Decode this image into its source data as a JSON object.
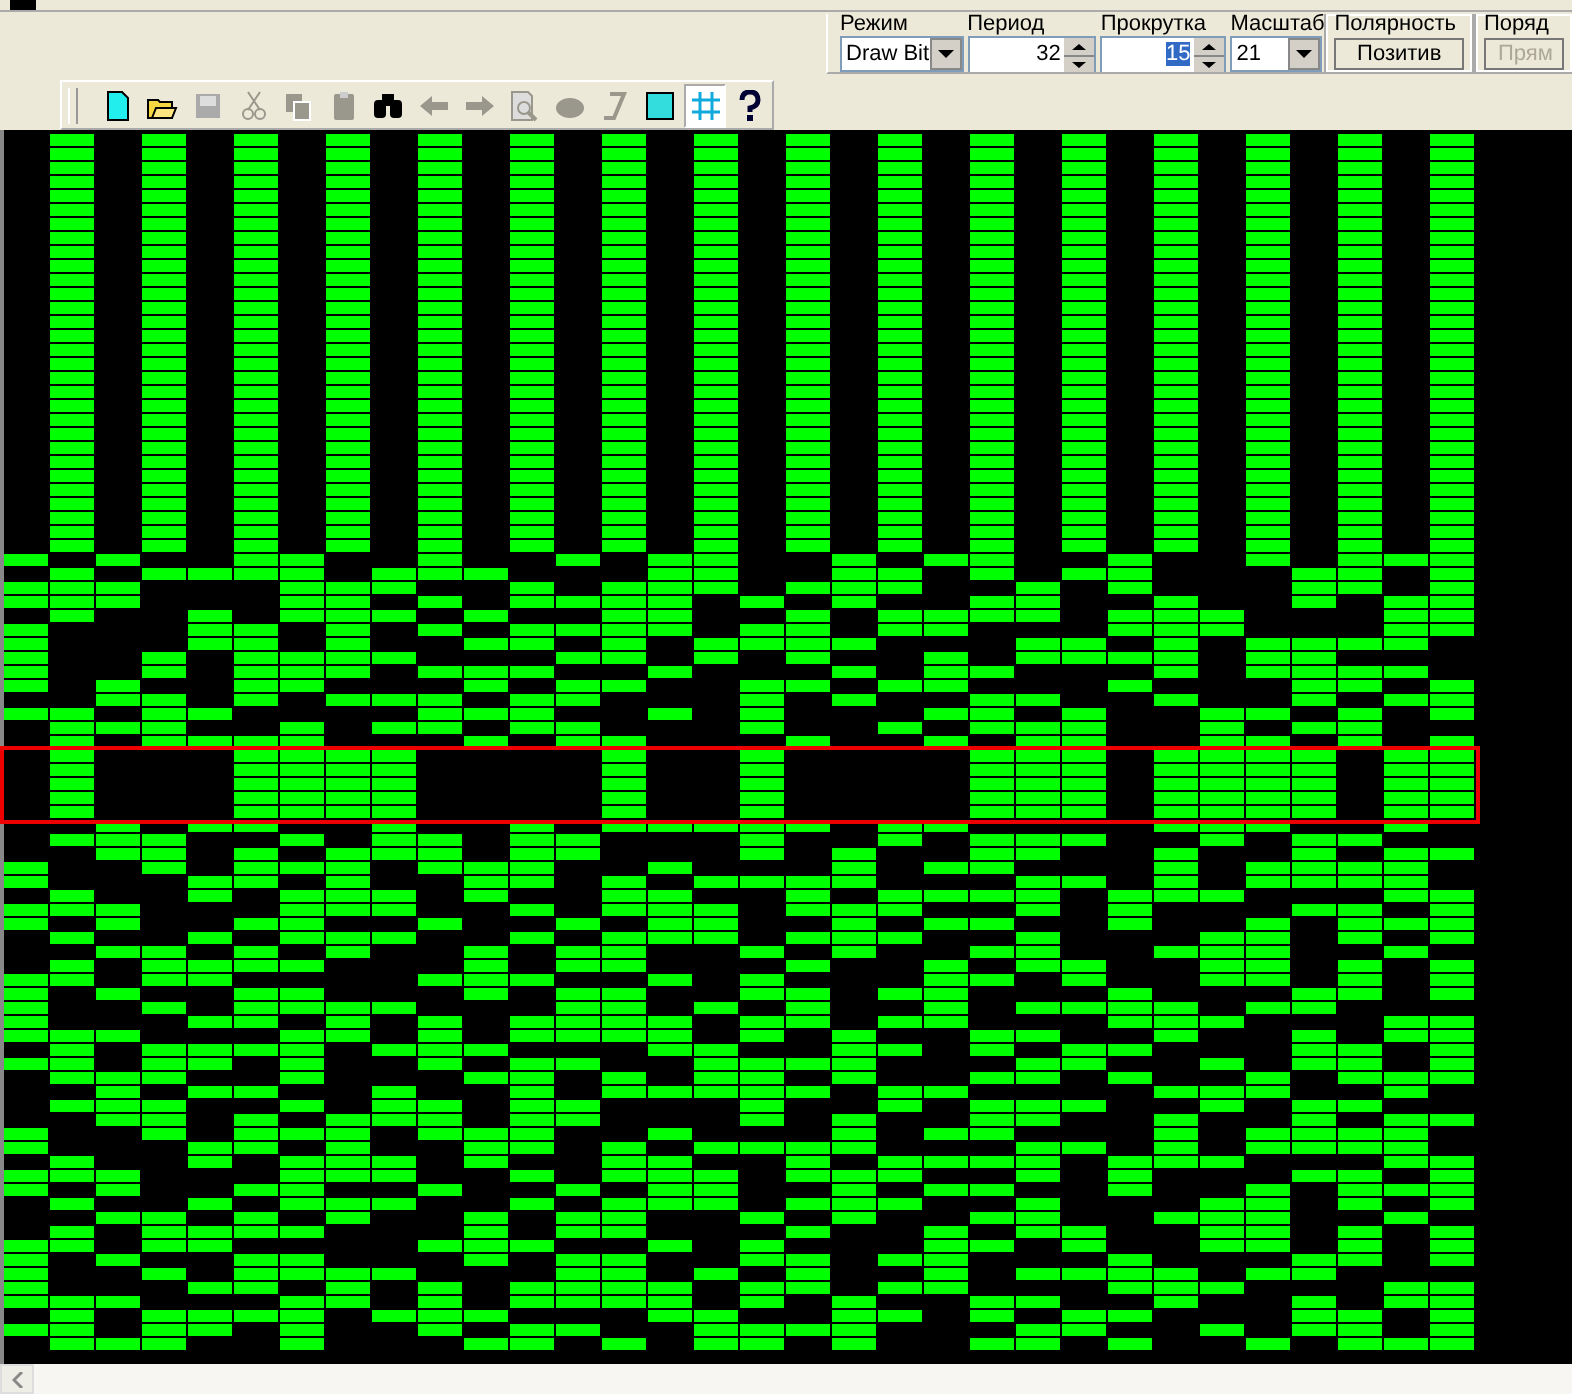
{
  "controls": [
    {
      "label": "Режим",
      "kind": "dropdown",
      "value": "Draw Bit",
      "focused": false,
      "disabled": false
    },
    {
      "label": "Период",
      "kind": "spinner",
      "value": "32",
      "focused": false,
      "disabled": false
    },
    {
      "label": "Прокрутка",
      "kind": "spinner",
      "value": "15",
      "focused": true,
      "disabled": false
    },
    {
      "label": "Масштаб",
      "kind": "dropdown",
      "value": "21",
      "focused": false,
      "disabled": false
    },
    {
      "label": "Полярность",
      "kind": "button",
      "value": "Позитив",
      "focused": false,
      "disabled": false
    },
    {
      "label": "Поряд",
      "kind": "button",
      "value": "Прям",
      "focused": false,
      "disabled": true
    }
  ],
  "toolbar": [
    {
      "disabled": false,
      "selected": false
    },
    {
      "disabled": false,
      "selected": false
    },
    {
      "disabled": true,
      "selected": false
    },
    {
      "disabled": true,
      "selected": false
    },
    {
      "disabled": true,
      "selected": false
    },
    {
      "disabled": true,
      "selected": false
    },
    {
      "disabled": false,
      "selected": false
    },
    {
      "disabled": true,
      "selected": false
    },
    {
      "disabled": true,
      "selected": false
    },
    {
      "disabled": true,
      "selected": false
    },
    {
      "disabled": true,
      "selected": false
    },
    {
      "disabled": true,
      "selected": false
    },
    {
      "disabled": false,
      "selected": false
    },
    {
      "disabled": false,
      "selected": true
    },
    {
      "disabled": false,
      "selected": false
    }
  ],
  "scrollbar": {
    "left_disabled": false
  }
}
